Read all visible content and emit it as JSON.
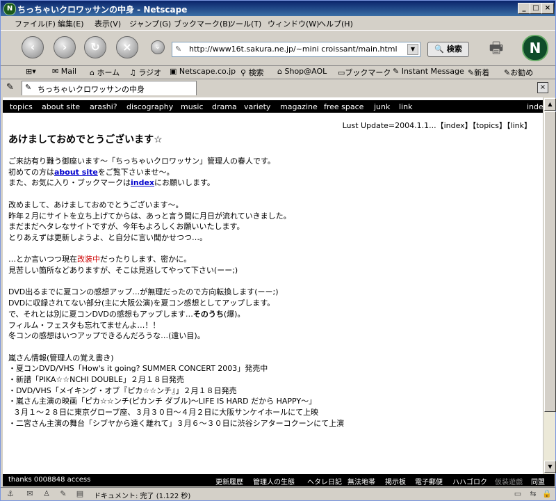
{
  "window": {
    "title": "ちっちゃいクロワッサンの中身 - Netscape"
  },
  "menu": [
    "ファイル(F)",
    "編集(E)",
    "表示(V)",
    "ジャンプ(G)",
    "ブックマーク(B)",
    "ツール(T)",
    "ウィンドウ(W)",
    "ヘルプ(H)"
  ],
  "navbar": {
    "url": "http://www16t.sakura.ne.jp/~mini croissant/main.html",
    "search_label": "検索"
  },
  "personal_bar": [
    "Mail",
    "ホーム",
    "ラジオ",
    "Netscape.co.jp",
    "検索",
    "Shop@AOL",
    "ブックマーク",
    "Instant Message",
    "新着",
    "お勧め"
  ],
  "tab": {
    "title": "ちっちゃいクロワッサンの中身"
  },
  "site_nav": [
    "topics",
    "about site",
    "arashi?",
    "discography",
    "music",
    "drama",
    "variety",
    "magazine",
    "free space",
    "junk",
    "link"
  ],
  "site_nav_right": "index",
  "update_line": "Lust Update=2004.1.1...【index】【topics】【link】",
  "heading": "あけましておめでとうございます☆",
  "paragraphs": {
    "p1_l1": "ご来訪有り難う御座います〜「ちっちゃいクロワッサン」管理人の春人です。",
    "p1_l2_pre": "初めての方は",
    "p1_l2_link": "about site",
    "p1_l2_post": "をご覧下さいませ〜。",
    "p1_l3_pre": "また、お気に入り・ブックマークは",
    "p1_l3_link": "index",
    "p1_l3_post": "にお願いします。",
    "p2_l1": "改めまして、あけましておめでとうございます〜。",
    "p2_l2": "昨年２月にサイトを立ち上げてからは、あっと言う間に月日が流れていきました。",
    "p2_l3": "まだまだヘタレなサイトですが、今年もよろしくお願いいたします。",
    "p2_l4": "とりあえずは更新しようよ、と自分に言い聞かせつつ…。",
    "p3_l1_pre": "…とか言いつつ現在",
    "p3_l1_red": "改装中",
    "p3_l1_post": "だったりします、密かに。",
    "p3_l2": "見苦しい箇所などありますが、そこは見逃してやって下さい(ーー;)",
    "p4_l1": "DVD出るまでに夏コンの感想アップ…が無理だったので方向転換します(ーー;)",
    "p4_l2": "DVDに収録されてない部分(主に大阪公演)を夏コン感想としてアップします。",
    "p4_l3_pre": "で、それとは別に夏コンDVDの感想もアップします…",
    "p4_l3_bold": "そのうち",
    "p4_l3_post": "(爆)。",
    "p4_l4": "フィルム・フェスタも忘れてませんよ…！！",
    "p4_l5": "冬コンの感想はいつアップできるんだろうな…(遠い目)。",
    "p5_l1": "嵐さん情報(管理人の覚え書き)",
    "p5_l2": "・夏コンDVD/VHS「How's it going?  SUMMER  CONCERT  2003」発売中",
    "p5_l3": "・新譜「PIKA☆☆NCHI  DOUBLE」２月１８日発売",
    "p5_l4": "・DVD/VHS「メイキング・オブ『ピカ☆☆ンチ』」２月１８日発売",
    "p5_l5": "・嵐さん主演の映画「ピカ☆☆ンチ(ピカンチ ダブル)〜LIFE IS HARD だから HAPPY〜」",
    "p5_l6": "  ３月１〜２８日に東京グローブ座、３月３０日〜４月２日に大阪サンケイホールにて上映",
    "p5_l7": "・二宮さん主演の舞台「シブヤから遠く離れて」３月６〜３０日に渋谷シアターコクーンにて上演"
  },
  "footer": {
    "counter": "thanks 0008848 access",
    "links": [
      "更新履歴",
      "管理人の生態",
      "ヘタレ日記",
      "無法地帯",
      "掲示板",
      "電子郵便",
      "ハハゴロク",
      "仮装遊戯",
      "同盟"
    ]
  },
  "status": {
    "text": "ドキュメント: 完了 (1.122 秒)"
  }
}
